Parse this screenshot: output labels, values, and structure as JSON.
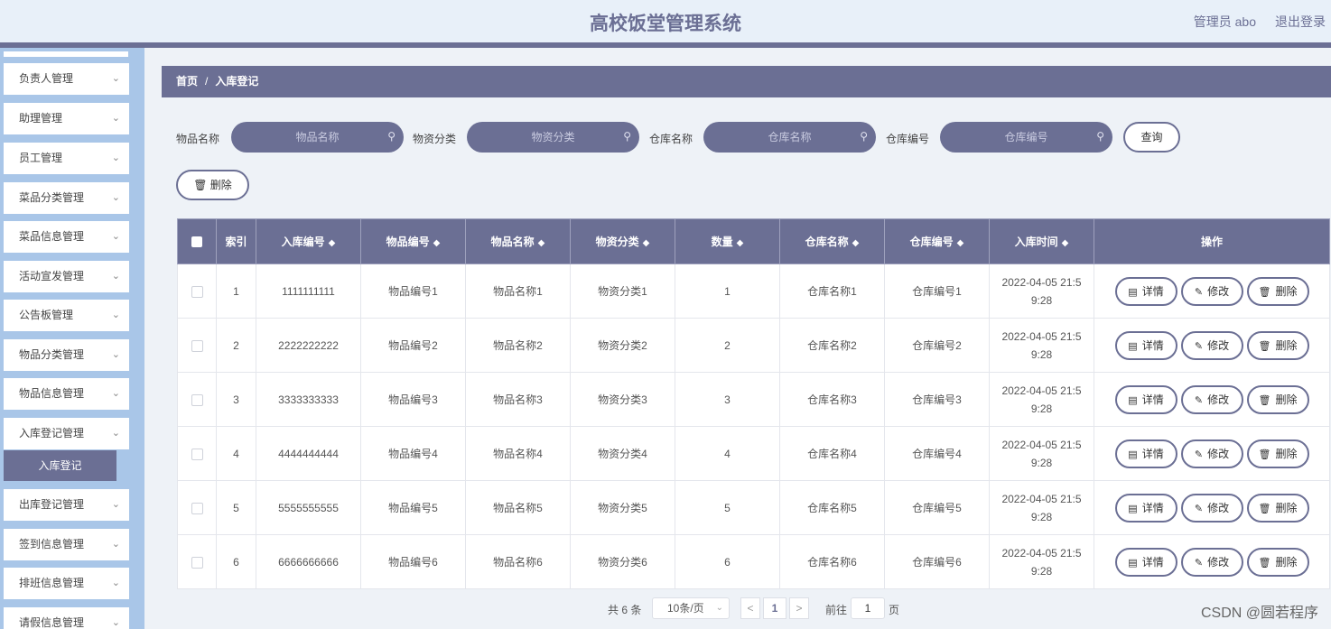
{
  "header": {
    "title": "高校饭堂管理系统",
    "admin": "管理员 abo",
    "logout": "退出登录"
  },
  "sidebar": {
    "items": [
      {
        "label": "负责人管理"
      },
      {
        "label": "助理管理"
      },
      {
        "label": "员工管理"
      },
      {
        "label": "菜品分类管理"
      },
      {
        "label": "菜品信息管理"
      },
      {
        "label": "活动宣发管理"
      },
      {
        "label": "公告板管理"
      },
      {
        "label": "物品分类管理"
      },
      {
        "label": "物品信息管理"
      },
      {
        "label": "入库登记管理"
      },
      {
        "label": "出库登记管理"
      },
      {
        "label": "签到信息管理"
      },
      {
        "label": "排班信息管理"
      },
      {
        "label": "请假信息管理"
      }
    ],
    "active_sub": "入库登记"
  },
  "breadcrumb": {
    "home": "首页",
    "separator": "/",
    "current": "入库登记"
  },
  "search": {
    "fields": [
      {
        "label": "物品名称",
        "placeholder": "物品名称"
      },
      {
        "label": "物资分类",
        "placeholder": "物资分类"
      },
      {
        "label": "仓库名称",
        "placeholder": "仓库名称"
      },
      {
        "label": "仓库编号",
        "placeholder": "仓库编号"
      }
    ],
    "query_label": "查询"
  },
  "actions": {
    "delete_label": "删除"
  },
  "table": {
    "columns": [
      "索引",
      "入库编号",
      "物品编号",
      "物品名称",
      "物资分类",
      "数量",
      "仓库名称",
      "仓库编号",
      "入库时间",
      "操作"
    ],
    "rows": [
      {
        "idx": "1",
        "in_no": "1111111111",
        "item_no": "物品编号1",
        "item_name": "物品名称1",
        "category": "物资分类1",
        "qty": "1",
        "wh_name": "仓库名称1",
        "wh_no": "仓库编号1",
        "time1": "2022-04-05 21:5",
        "time2": "9:28"
      },
      {
        "idx": "2",
        "in_no": "2222222222",
        "item_no": "物品编号2",
        "item_name": "物品名称2",
        "category": "物资分类2",
        "qty": "2",
        "wh_name": "仓库名称2",
        "wh_no": "仓库编号2",
        "time1": "2022-04-05 21:5",
        "time2": "9:28"
      },
      {
        "idx": "3",
        "in_no": "3333333333",
        "item_no": "物品编号3",
        "item_name": "物品名称3",
        "category": "物资分类3",
        "qty": "3",
        "wh_name": "仓库名称3",
        "wh_no": "仓库编号3",
        "time1": "2022-04-05 21:5",
        "time2": "9:28"
      },
      {
        "idx": "4",
        "in_no": "4444444444",
        "item_no": "物品编号4",
        "item_name": "物品名称4",
        "category": "物资分类4",
        "qty": "4",
        "wh_name": "仓库名称4",
        "wh_no": "仓库编号4",
        "time1": "2022-04-05 21:5",
        "time2": "9:28"
      },
      {
        "idx": "5",
        "in_no": "5555555555",
        "item_no": "物品编号5",
        "item_name": "物品名称5",
        "category": "物资分类5",
        "qty": "5",
        "wh_name": "仓库名称5",
        "wh_no": "仓库编号5",
        "time1": "2022-04-05 21:5",
        "time2": "9:28"
      },
      {
        "idx": "6",
        "in_no": "6666666666",
        "item_no": "物品编号6",
        "item_name": "物品名称6",
        "category": "物资分类6",
        "qty": "6",
        "wh_name": "仓库名称6",
        "wh_no": "仓库编号6",
        "time1": "2022-04-05 21:5",
        "time2": "9:28"
      }
    ],
    "row_actions": {
      "detail": "详情",
      "edit": "修改",
      "delete": "删除"
    }
  },
  "pagination": {
    "total": "共 6 条",
    "page_size": "10条/页",
    "prev": "<",
    "current": "1",
    "next": ">",
    "goto_label": "前往",
    "goto_value": "1",
    "page_unit": "页"
  },
  "watermark": "CSDN @圆若程序",
  "icons": {
    "search": "search-icon",
    "trash": "trash-icon",
    "detail": "document-icon",
    "edit": "pencil-icon",
    "chevron": "chevron-down-icon",
    "sort": "sort-icon"
  },
  "colors": {
    "primary": "#6b6f94",
    "sidebar_bg": "#a9c6e8",
    "header_bg": "#e8f0f9"
  }
}
